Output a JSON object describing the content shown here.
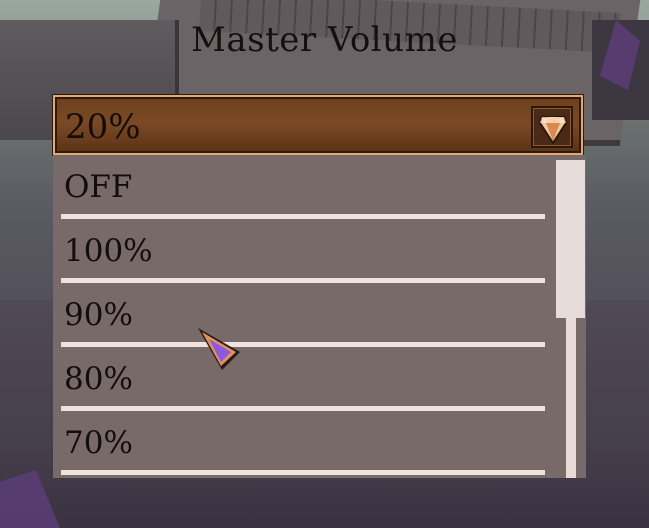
{
  "title": "Master Volume",
  "dropdown": {
    "selected": "20%",
    "toggle_icon": "gem-arrow-icon",
    "options": [
      {
        "label": "OFF"
      },
      {
        "label": "100%"
      },
      {
        "label": "90%"
      },
      {
        "label": "80%"
      },
      {
        "label": "70%"
      }
    ]
  },
  "scrollbar": {
    "position_fraction": 0.0,
    "visible_fraction": 0.5
  },
  "colors": {
    "header_brown": "#7a4a26",
    "header_border": "#e3a874",
    "list_background": "#786a69",
    "divider": "#efe1dc",
    "cursor_fill": "#8a5ae0",
    "cursor_border": "#e0925e"
  }
}
